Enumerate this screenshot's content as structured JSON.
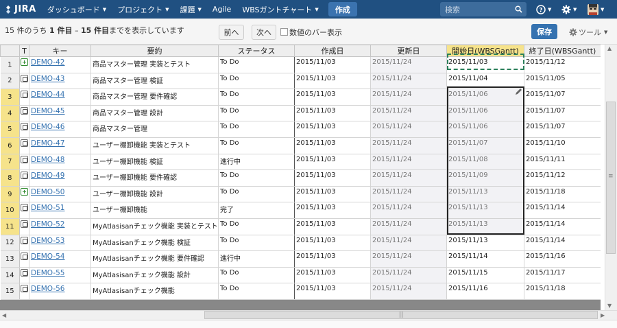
{
  "nav": {
    "logo": "JIRA",
    "items": [
      {
        "label": "ダッシュボード",
        "caret": true
      },
      {
        "label": "プロジェクト",
        "caret": true
      },
      {
        "label": "課題",
        "caret": true
      },
      {
        "label": "Agile",
        "caret": false
      },
      {
        "label": "WBSガントチャート",
        "caret": true
      }
    ],
    "create": "作成",
    "search_placeholder": "検索",
    "help_icon": "help-icon",
    "settings_icon": "gear-icon",
    "avatar_icon": "avatar"
  },
  "toolbar": {
    "count_prefix": "15 件のうち ",
    "count_from": "1 件目",
    "count_mid": " – ",
    "count_to": "15 件目",
    "count_suffix": "までを表示しています",
    "prev": "前へ",
    "next": "次へ",
    "bar_checkbox_label": "数値のバー表示",
    "bar_checkbox_checked": false,
    "save": "保存",
    "tools": "ツール"
  },
  "columns": {
    "t": "T",
    "key": "キー",
    "summary": "要約",
    "status": "ステータス",
    "created": "作成日",
    "updated": "更新日",
    "start": "開始日(WBSGantt)",
    "end": "終了日(WBSGantt)"
  },
  "colors": {
    "nav_bg": "#205081",
    "accent": "#3572b0",
    "selected_header": "#f6e38b",
    "link": "#3572b0"
  },
  "rows": [
    {
      "num": "1",
      "type": "story",
      "key": "DEMO-42",
      "summary": "商品マスター管理 実装とテスト",
      "status": "To Do",
      "created": "2015/11/03",
      "updated": "2015/11/24",
      "start": "2015/11/03",
      "end": "2015/11/12"
    },
    {
      "num": "2",
      "type": "sub",
      "key": "DEMO-43",
      "summary": "商品マスター管理 検証",
      "status": "To Do",
      "created": "2015/11/03",
      "updated": "2015/11/24",
      "start": "2015/11/04",
      "end": "2015/11/05"
    },
    {
      "num": "3",
      "type": "sub",
      "key": "DEMO-44",
      "summary": "商品マスター管理 要件確認",
      "status": "To Do",
      "created": "2015/11/03",
      "updated": "2015/11/24",
      "start": "2015/11/06",
      "end": "2015/11/07"
    },
    {
      "num": "4",
      "type": "sub",
      "key": "DEMO-45",
      "summary": "商品マスター管理 設計",
      "status": "To Do",
      "created": "2015/11/03",
      "updated": "2015/11/24",
      "start": "2015/11/06",
      "end": "2015/11/07"
    },
    {
      "num": "5",
      "type": "sub",
      "key": "DEMO-46",
      "summary": "商品マスター管理",
      "status": "To Do",
      "created": "2015/11/03",
      "updated": "2015/11/24",
      "start": "2015/11/06",
      "end": "2015/11/07"
    },
    {
      "num": "6",
      "type": "sub",
      "key": "DEMO-47",
      "summary": "ユーザー棚卸機能 実装とテスト",
      "status": "To Do",
      "created": "2015/11/03",
      "updated": "2015/11/24",
      "start": "2015/11/07",
      "end": "2015/11/10"
    },
    {
      "num": "7",
      "type": "sub",
      "key": "DEMO-48",
      "summary": "ユーザー棚卸機能 検証",
      "status": "進行中",
      "created": "2015/11/03",
      "updated": "2015/11/24",
      "start": "2015/11/08",
      "end": "2015/11/11"
    },
    {
      "num": "8",
      "type": "sub",
      "key": "DEMO-49",
      "summary": "ユーザー棚卸機能 要件確認",
      "status": "To Do",
      "created": "2015/11/03",
      "updated": "2015/11/24",
      "start": "2015/11/09",
      "end": "2015/11/12"
    },
    {
      "num": "9",
      "type": "story",
      "key": "DEMO-50",
      "summary": "ユーザー棚卸機能 設計",
      "status": "To Do",
      "created": "2015/11/03",
      "updated": "2015/11/24",
      "start": "2015/11/13",
      "end": "2015/11/18"
    },
    {
      "num": "10",
      "type": "sub",
      "key": "DEMO-51",
      "summary": "ユーザー棚卸機能",
      "status": "完了",
      "created": "2015/11/03",
      "updated": "2015/11/24",
      "start": "2015/11/13",
      "end": "2015/11/14"
    },
    {
      "num": "11",
      "type": "sub",
      "key": "DEMO-52",
      "summary": "MyAtlasisanチェック機能 実装とテスト",
      "status": "To Do",
      "created": "2015/11/03",
      "updated": "2015/11/24",
      "start": "2015/11/13",
      "end": "2015/11/14"
    },
    {
      "num": "12",
      "type": "sub",
      "key": "DEMO-53",
      "summary": "MyAtlasisanチェック機能 検証",
      "status": "To Do",
      "created": "2015/11/03",
      "updated": "2015/11/24",
      "start": "2015/11/13",
      "end": "2015/11/14"
    },
    {
      "num": "13",
      "type": "sub",
      "key": "DEMO-54",
      "summary": "MyAtlasisanチェック機能 要件確認",
      "status": "進行中",
      "created": "2015/11/03",
      "updated": "2015/11/24",
      "start": "2015/11/14",
      "end": "2015/11/16"
    },
    {
      "num": "14",
      "type": "sub",
      "key": "DEMO-55",
      "summary": "MyAtlasisanチェック機能 設計",
      "status": "To Do",
      "created": "2015/11/03",
      "updated": "2015/11/24",
      "start": "2015/11/15",
      "end": "2015/11/17"
    },
    {
      "num": "15",
      "type": "sub",
      "key": "DEMO-56",
      "summary": "MyAtlasisanチェック機能",
      "status": "To Do",
      "created": "2015/11/03",
      "updated": "2015/11/24",
      "start": "2015/11/16",
      "end": "2015/11/18"
    }
  ]
}
